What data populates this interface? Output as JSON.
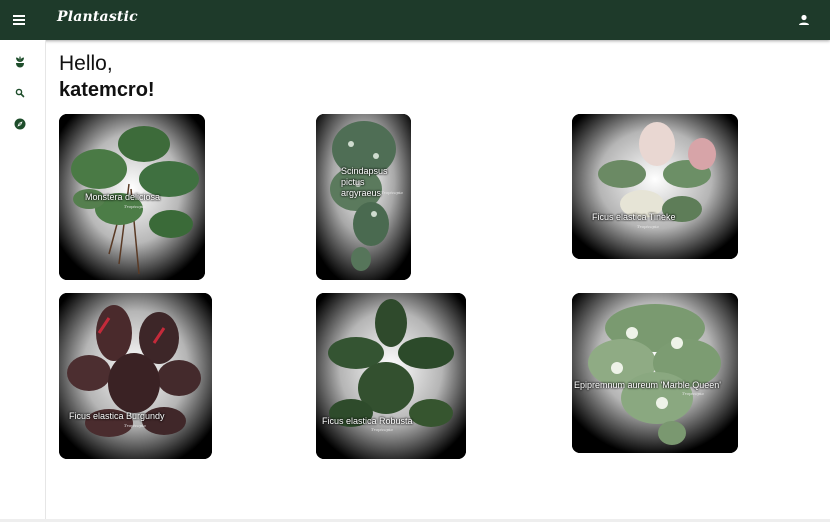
{
  "app": {
    "title": "Plantastic"
  },
  "header": {
    "menu_icon": "hamburger-menu-icon",
    "account_icon": "person-icon"
  },
  "sidebar": {
    "items": [
      {
        "icon": "plant-icon",
        "color": "#1e4d2b"
      },
      {
        "icon": "search-icon",
        "color": "#1e4d2b"
      },
      {
        "icon": "compass-icon",
        "color": "#1e4d2b"
      }
    ]
  },
  "greeting": {
    "line1": "Hello,",
    "username": "katemcro!"
  },
  "plants": [
    {
      "label": "Monstera deliciosa",
      "watermark": "Tropicopia"
    },
    {
      "label": "Scindapsus pictus argyraeus",
      "watermark": "Tropicopia"
    },
    {
      "label": "Ficus elastica Tineke",
      "watermark": "Tropicopia"
    },
    {
      "label": "Ficus elastica Burgundy",
      "watermark": "Tropicopia"
    },
    {
      "label": "Ficus elastica Robusta",
      "watermark": "Tropicopia"
    },
    {
      "label": "Epipremnum aureum 'Marble Queen'",
      "watermark": "Tropicopia"
    }
  ],
  "colors": {
    "header_bg": "#1e3a2a",
    "accent": "#1e4d2b",
    "card_bg": "#000000"
  }
}
